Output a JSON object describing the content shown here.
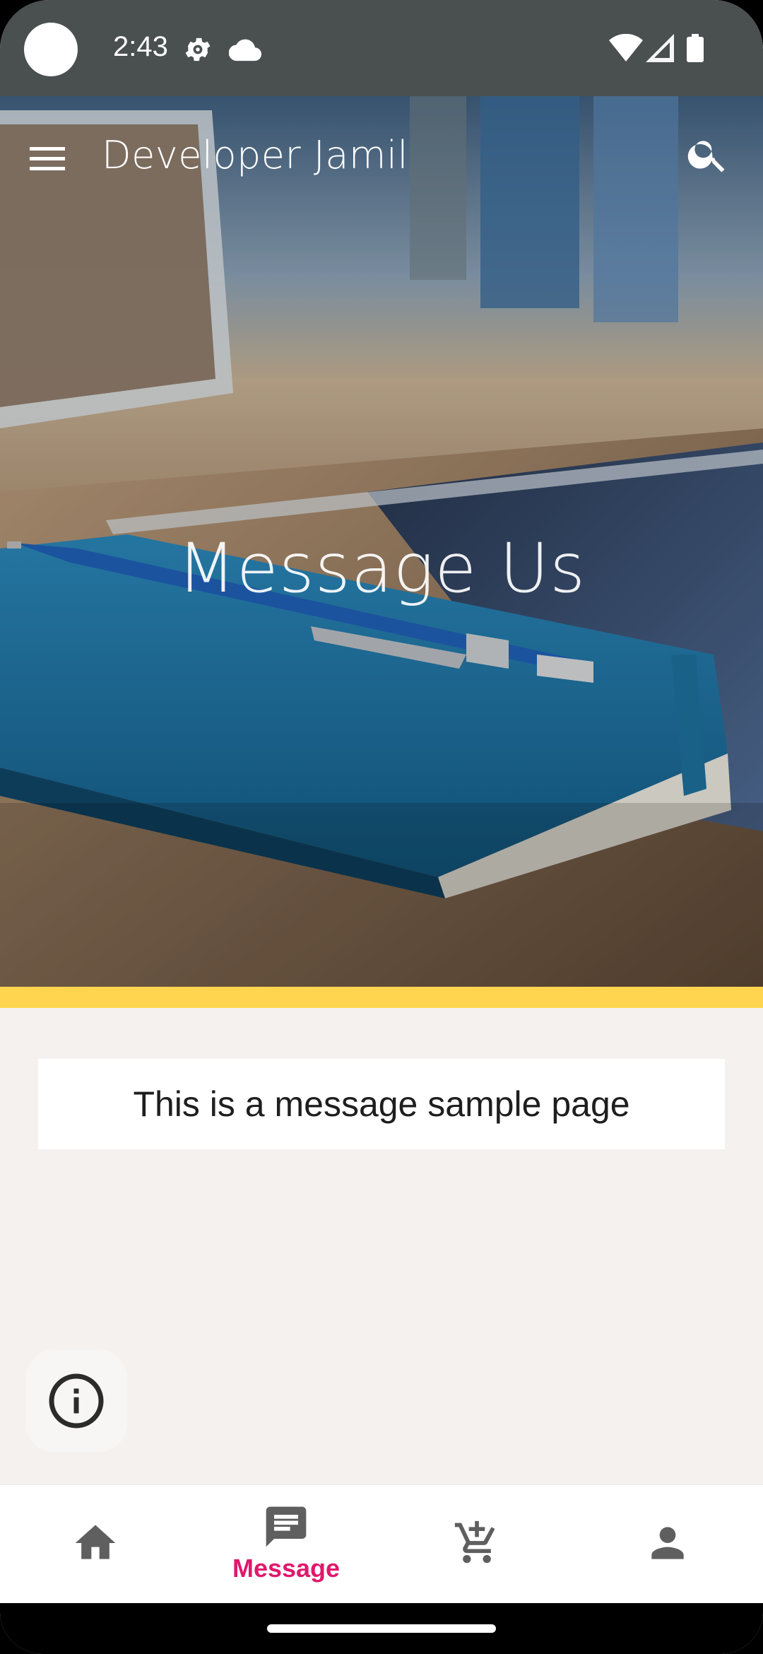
{
  "status_bar": {
    "time": "2:43",
    "icons": [
      "settings-icon",
      "cloud-icon",
      "wifi-icon",
      "signal-icon",
      "battery-icon"
    ]
  },
  "app_bar": {
    "title": "Developer Jamil",
    "menu_icon": "menu-icon",
    "search_icon": "search-icon"
  },
  "hero": {
    "title": "Message Us"
  },
  "content": {
    "message": "This is a message sample page"
  },
  "fab": {
    "icon": "info-icon"
  },
  "bottom_nav": {
    "items": [
      {
        "icon": "home-icon",
        "label": ""
      },
      {
        "icon": "message-icon",
        "label": "Message",
        "active": true
      },
      {
        "icon": "cart-add-icon",
        "label": ""
      },
      {
        "icon": "person-icon",
        "label": ""
      }
    ]
  },
  "colors": {
    "status_bar": "#4a4f50",
    "accent_strip": "#ffd54f",
    "active_nav": "#e0186c",
    "inactive_nav": "#5f5f5f",
    "page_bg": "#f4f1ee"
  }
}
